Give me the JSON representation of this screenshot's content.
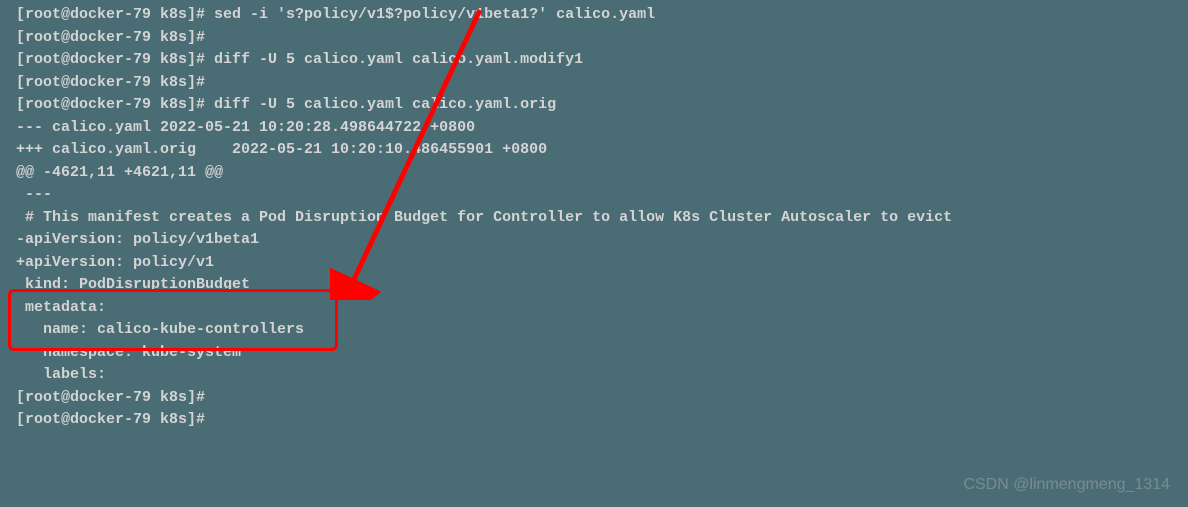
{
  "terminal": {
    "lines": [
      "[root@docker-79 k8s]# sed -i 's?policy/v1$?policy/v1beta1?' calico.yaml",
      "[root@docker-79 k8s]# ",
      "[root@docker-79 k8s]# diff -U 5 calico.yaml calico.yaml.modify1",
      "[root@docker-79 k8s]# ",
      "[root@docker-79 k8s]# diff -U 5 calico.yaml calico.yaml.orig",
      "--- calico.yaml 2022-05-21 10:20:28.498644722 +0800",
      "+++ calico.yaml.orig    2022-05-21 10:20:10.486455901 +0800",
      "@@ -4621,11 +4621,11 @@",
      "",
      " ---",
      "",
      " # This manifest creates a Pod Disruption Budget for Controller to allow K8s Cluster Autoscaler to evict",
      "",
      "-apiVersion: policy/v1beta1",
      "+apiVersion: policy/v1",
      " kind: PodDisruptionBudget",
      " metadata:",
      "   name: calico-kube-controllers",
      "   namespace: kube-system",
      "   labels:",
      "[root@docker-79 k8s]# ",
      "[root@docker-79 k8s]# "
    ]
  },
  "watermark": "CSDN @linmengmeng_1314"
}
